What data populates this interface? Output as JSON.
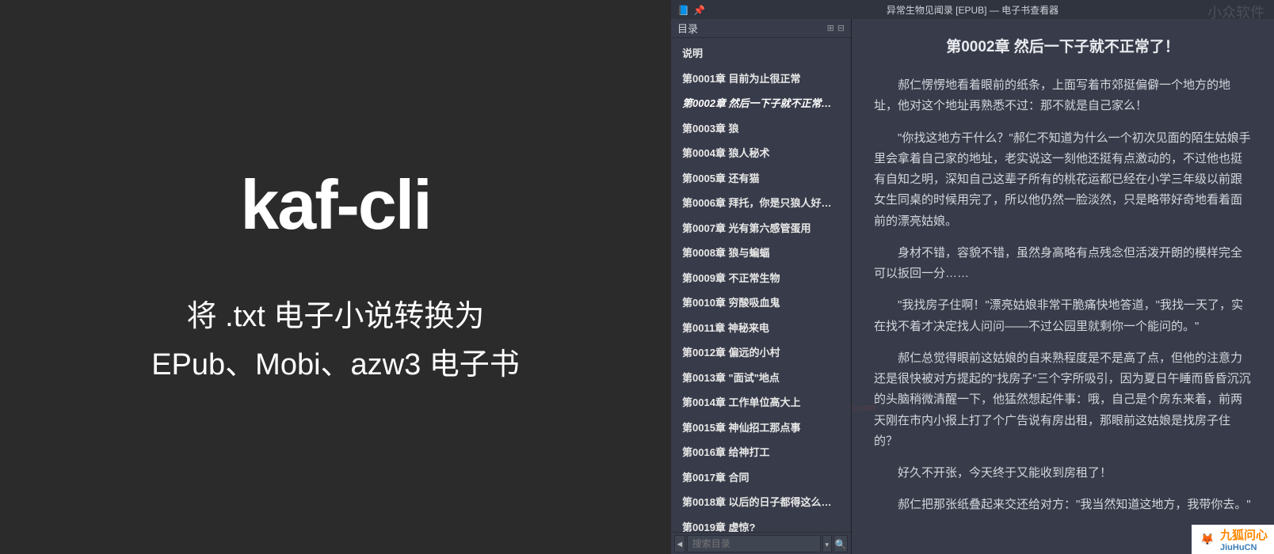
{
  "left": {
    "title": "kaf-cli",
    "subtitle_line1": "将 .txt 电子小说转换为",
    "subtitle_line2": "EPub、Mobi、azw3 电子书"
  },
  "window": {
    "title": "异常生物见闻录 [EPUB] — 电子书查看器",
    "watermark_top": "小众软件",
    "close_glyph": "✕"
  },
  "titlebar_icons": {
    "book": "📘",
    "pin": "📌"
  },
  "toc": {
    "header": "目录",
    "icon_grid": "⊞",
    "icon_collapse": "⊟",
    "search_placeholder": "搜索目录",
    "nav_prev": "◄",
    "drop": "▾",
    "search_glyph": "🔍",
    "items": [
      {
        "label": "说明",
        "active": false
      },
      {
        "label": "第0001章 目前为止很正常",
        "active": false
      },
      {
        "label": "第0002章 然后一下子就不正常…",
        "active": true
      },
      {
        "label": "第0003章 狼",
        "active": false
      },
      {
        "label": "第0004章 狼人秘术",
        "active": false
      },
      {
        "label": "第0005章 还有猫",
        "active": false
      },
      {
        "label": "第0006章 拜托，你是只狼人好…",
        "active": false
      },
      {
        "label": "第0007章 光有第六感管蛋用",
        "active": false
      },
      {
        "label": "第0008章 狼与蝙蝠",
        "active": false
      },
      {
        "label": "第0009章 不正常生物",
        "active": false
      },
      {
        "label": "第0010章 穷酸吸血鬼",
        "active": false
      },
      {
        "label": "第0011章 神秘来电",
        "active": false
      },
      {
        "label": "第0012章 偏远的小村",
        "active": false
      },
      {
        "label": "第0013章 \"面试\"地点",
        "active": false
      },
      {
        "label": "第0014章 工作单位高大上",
        "active": false
      },
      {
        "label": "第0015章 神仙招工那点事",
        "active": false
      },
      {
        "label": "第0016章 给神打工",
        "active": false
      },
      {
        "label": "第0017章 合同",
        "active": false
      },
      {
        "label": "第0018章 以后的日子都得这么…",
        "active": false
      },
      {
        "label": "第0019章 虚惊?",
        "active": false
      }
    ]
  },
  "content": {
    "title": "第0002章 然后一下子就不正常了！",
    "paragraphs": [
      "郝仁愣愣地看着眼前的纸条，上面写着市郊挺偏僻一个地方的地址，他对这个地址再熟悉不过：那不就是自己家么！",
      "\"你找这地方干什么？\"郝仁不知道为什么一个初次见面的陌生姑娘手里会拿着自己家的地址，老实说这一刻他还挺有点激动的，不过他也挺有自知之明，深知自己这辈子所有的桃花运都已经在小学三年级以前跟女生同桌的时候用完了，所以他仍然一脸淡然，只是略带好奇地看着面前的漂亮姑娘。",
      "身材不错，容貌不错，虽然身高略有点残念但活泼开朗的模样完全可以扳回一分……",
      "\"我找房子住啊！\"漂亮姑娘非常干脆痛快地答道，\"我找一天了，实在找不着才决定找人问问——不过公园里就剩你一个能问的。\"",
      "郝仁总觉得眼前这姑娘的自来熟程度是不是高了点，但他的注意力还是很快被对方提起的\"找房子\"三个字所吸引，因为夏日午睡而昏昏沉沉的头脑稍微清醒一下，他猛然想起件事：哦，自己是个房东来着，前两天刚在市内小报上打了个广告说有房出租，那眼前这姑娘是找房子住的？",
      "好久不开张，今天终于又能收到房租了！",
      "郝仁把那张纸叠起来交还给对方：\"我当然知道这地方，我带你去。\""
    ]
  },
  "watermarks": {
    "mid": "appinn.com",
    "fox": "🦊",
    "bottom_cn": "九狐问心",
    "bottom_en": "JiuHuCN"
  }
}
